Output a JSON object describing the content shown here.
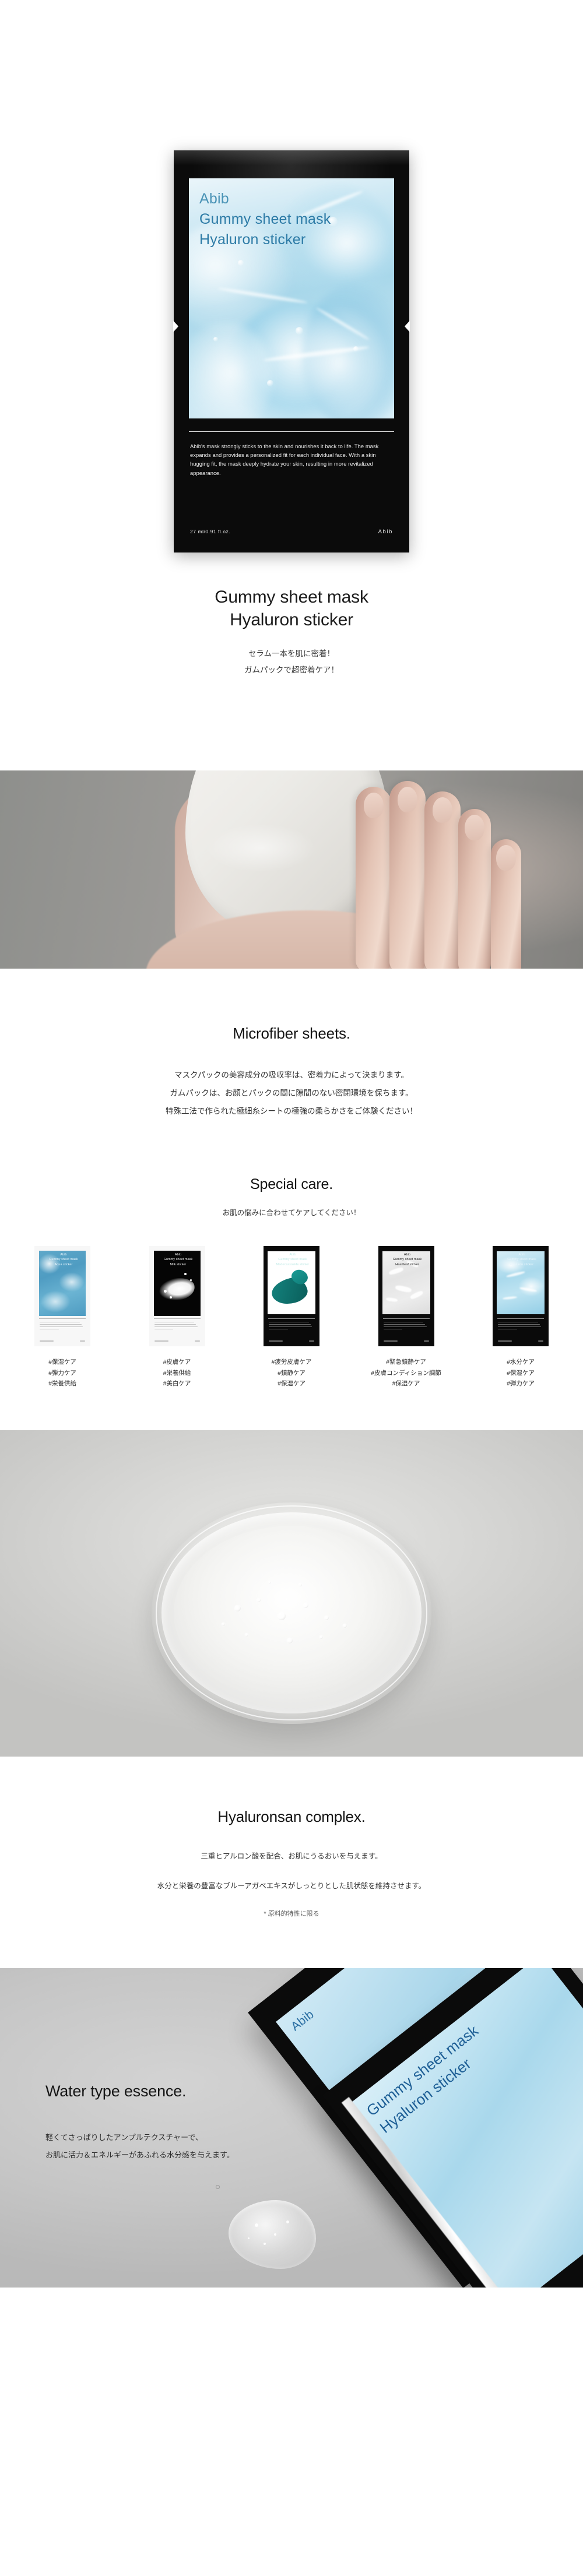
{
  "hero": {
    "package": {
      "brand": "Abib",
      "line1": "Gummy sheet mask",
      "line2": "Hyaluron sticker",
      "body": "Abib's mask strongly sticks to the skin and nourishes it back to life. The mask expands and provides a personalized fit for each individual face. With a skin hugging fit, the mask deeply hydrate your skin, resulting in more revitalized appearance.",
      "volume": "27 ml/0.91 fl.oz.",
      "brand_mark": "Abib"
    },
    "title_line1": "Gummy sheet mask",
    "title_line2": "Hyaluron sticker",
    "sub_line1": "セラム一本を肌に密着！",
    "sub_line2": "ガムパックで超密着ケア！"
  },
  "microfiber": {
    "heading": "Microfiber sheets.",
    "body_line1": "マスクパックの美容成分の吸収率は、密着力によって決まります。",
    "body_line2": "ガムパックは、お顔とパックの間に隙間のない密閉環境を保ちます。",
    "body_line3": "特殊工法で作られた極細糸シートの極強の柔らかさをご体験ください！"
  },
  "special_care": {
    "heading": "Special care.",
    "lead": "お肌の悩みに合わせてケアしてください！",
    "variants": [
      {
        "brand": "Abib",
        "line1": "Gummy sheet mask",
        "line2": "Aqua sticker",
        "tags": [
          "#保湿ケア",
          "#弾力ケア",
          "#栄養供給"
        ]
      },
      {
        "brand": "Abib",
        "line1": "Gummy sheet mask",
        "line2": "Milk sticker",
        "tags": [
          "#皮膚ケア",
          "#栄養供給",
          "#美白ケア"
        ]
      },
      {
        "brand": "Abib",
        "line1": "Gummy sheet mask",
        "line2": "Madecassoside sticker",
        "tags": [
          "#疲労皮膚ケア",
          "#鎮静ケア",
          "#保湿ケア"
        ]
      },
      {
        "brand": "Abib",
        "line1": "Gummy sheet mask",
        "line2": "Heartleaf sticker",
        "tags": [
          "#緊急鎮静ケア",
          "#皮膚コンディション調節",
          "#保湿ケア"
        ]
      },
      {
        "brand": "Abib",
        "line1": "Gummy sheet mask",
        "line2": "Hyaluron sticker",
        "tags": [
          "#水分ケア",
          "#保湿ケア",
          "#弾力ケア"
        ]
      }
    ]
  },
  "hyaluronsan": {
    "heading": "Hyaluronsan complex.",
    "body_line1": "三重ヒアルロン酸を配合、お肌にうるおいを与えます。",
    "body_line2": "水分と栄養の豊富なブルーアガベエキスがしっとりとした肌状態を維持させます。",
    "note": "* 原料的特性に限る"
  },
  "water_essence": {
    "heading": "Water type essence.",
    "body_line1": "軽くてさっぱりしたアンプルテクスチャーで、",
    "body_line2": "お肌に活力＆エネルギーがあふれる水分感を与えます。",
    "pack_brand": "Abib",
    "pack_line1": "Gummy sheet mask",
    "pack_line2": "Hyaluron sticker"
  },
  "colors": {
    "accent_blue": "#2d7ba6",
    "package_black": "#0b0b0b",
    "text_dark": "#1a1a1a",
    "photo_gray": "#c9c9c9"
  }
}
